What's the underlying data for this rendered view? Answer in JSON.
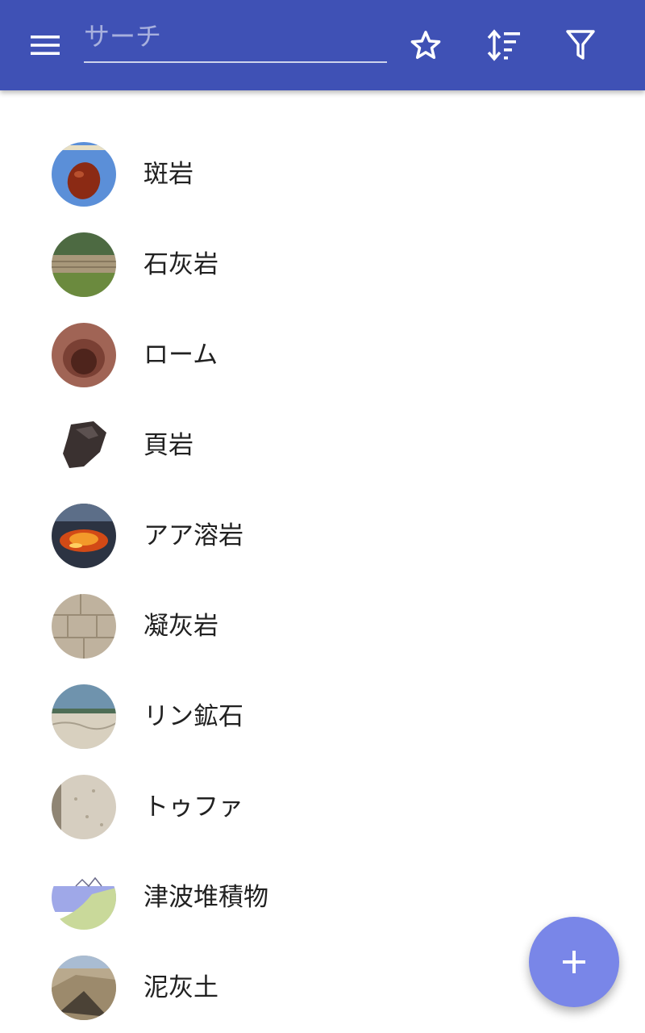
{
  "header": {
    "search_placeholder": "サーチ",
    "search_value": "",
    "bg_color": "#3f51b5"
  },
  "icons": {
    "menu": "menu-icon",
    "favorites": "star-outline-icon",
    "sort": "sort-icon",
    "filter": "filter-icon",
    "add": "plus-icon"
  },
  "items": [
    {
      "label": "斑岩",
      "thumb": "red-stone-on-blue"
    },
    {
      "label": "石灰岩",
      "thumb": "stone-wall-grass"
    },
    {
      "label": "ローム",
      "thumb": "soil-pit"
    },
    {
      "label": "頁岩",
      "thumb": "dark-rock-on-white"
    },
    {
      "label": "アア溶岩",
      "thumb": "lava-flow"
    },
    {
      "label": "凝灰岩",
      "thumb": "tuff-blocks"
    },
    {
      "label": "リン鉱石",
      "thumb": "phosphate-field"
    },
    {
      "label": "トゥファ",
      "thumb": "tufa-surface"
    },
    {
      "label": "津波堆積物",
      "thumb": "tsunami-diagram"
    },
    {
      "label": "泥灰土",
      "thumb": "marl-cliff"
    }
  ],
  "fab": {
    "color": "#7986e8"
  }
}
